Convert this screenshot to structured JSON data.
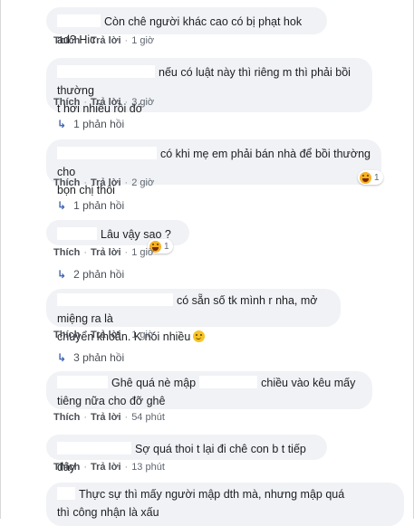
{
  "actions": {
    "like": "Thích",
    "reply": "Trả lời",
    "separator": "·"
  },
  "comments": [
    {
      "text": "Còn chê người khác cao có bị phạt hok ad? Hic",
      "time": "1 giờ"
    },
    {
      "line1": "nếu có luật này thì riêng m thì phải bồi thường",
      "line2": "t hơi nhiều rồi đó",
      "time": "3 giờ",
      "replies": "1 phản hồi"
    },
    {
      "line1": "có khi mẹ em phải bán nhà để bồi thường cho",
      "line2": "bọn chị thôi",
      "time": "2 giờ",
      "reaction_count": "1",
      "replies": "1 phản hồi"
    },
    {
      "text": "Lâu vậy sao ?",
      "time": "1 giờ",
      "reaction_count": "1",
      "replies": "2 phản hồi"
    },
    {
      "line1": "có sẵn số tk mình r nha, mở miệng ra là",
      "line2": "chuyển khoản. K nói nhiều",
      "time": "1 giờ",
      "replies": "3 phản hồi"
    },
    {
      "line1a": "Ghê quá nè mập",
      "line1b": "chiều vào kêu mấy",
      "line2": "tiêng nữa cho đỡ ghê",
      "time": "54 phút"
    },
    {
      "text": "Sợ quá thoi t lại đi chê con b t tiếp đây",
      "time": "13 phút"
    },
    {
      "line1": "Thực sự thì mấy người mập dth mà, nhưng mập quá",
      "line2": "thì công nhận là xấu"
    }
  ],
  "colors": {
    "bubble": "#f0f2f5",
    "link": "#4267b2",
    "meta": "#606770"
  }
}
